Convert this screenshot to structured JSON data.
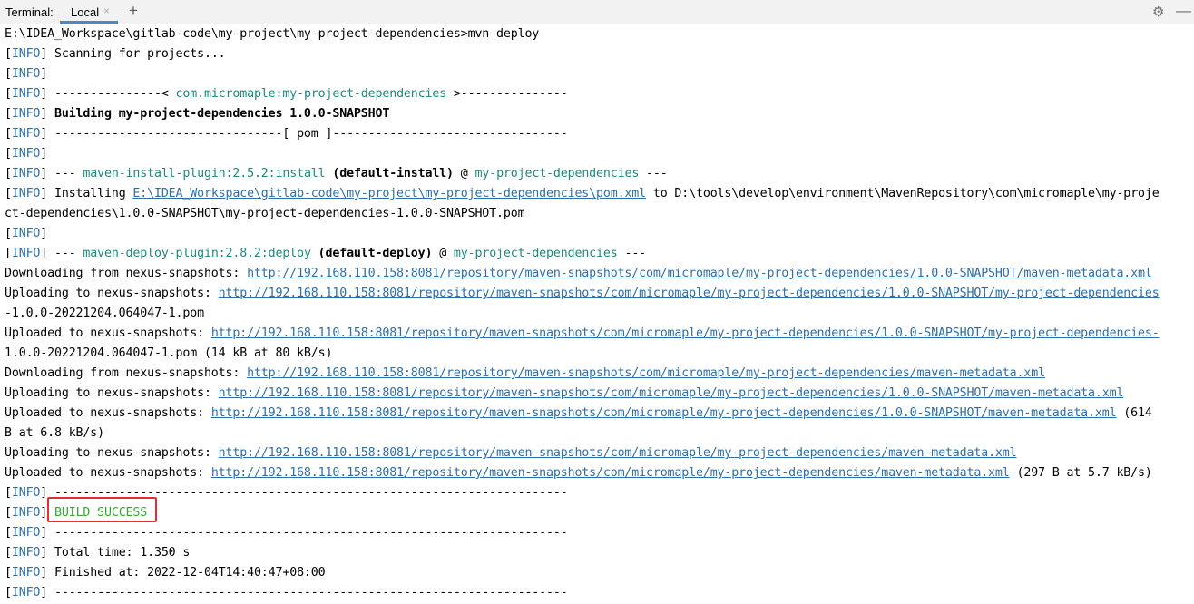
{
  "toolbar": {
    "title": "Terminal:",
    "tab_label": "Local",
    "tab_close": "×",
    "add": "+",
    "settings": "⚙",
    "minimize": "—"
  },
  "info_tag": "INFO",
  "lines": {
    "l0": "E:\\IDEA_Workspace\\gitlab-code\\my-project\\my-project-dependencies>mvn deploy",
    "l1": " Scanning for projects...",
    "l3a": " ---------------< ",
    "l3b": "com.micromaple:my-project-dependencies",
    "l3c": " >---------------",
    "l4": " Building my-project-dependencies 1.0.0-SNAPSHOT",
    "l5": " --------------------------------[ pom ]---------------------------------",
    "l7a": " --- ",
    "l7b": "maven-install-plugin:2.5.2:install",
    "l7c": "(default-install)",
    "l7d": " @ ",
    "l7e": "my-project-dependencies",
    "l7f": " ---",
    "l8a": " Installing ",
    "l8b": "E:\\IDEA_Workspace\\gitlab-code\\my-project\\my-project-dependencies\\pom.xml",
    "l8c": " to D:\\tools\\develop\\environment\\MavenRepository\\com\\micromaple\\my-proje",
    "l9": "ct-dependencies\\1.0.0-SNAPSHOT\\my-project-dependencies-1.0.0-SNAPSHOT.pom",
    "l11a": " --- ",
    "l11b": "maven-deploy-plugin:2.8.2:deploy",
    "l11c": "(default-deploy)",
    "l11d": " @ ",
    "l11e": "my-project-dependencies",
    "l11f": " ---",
    "l12a": "Downloading from nexus-snapshots: ",
    "l12b": "http://192.168.110.158:8081/repository/maven-snapshots/com/micromaple/my-project-dependencies/1.0.0-SNAPSHOT/maven-metadata.xml",
    "l13a": "Uploading to nexus-snapshots: ",
    "l13b": "http://192.168.110.158:8081/repository/maven-snapshots/com/micromaple/my-project-dependencies/1.0.0-SNAPSHOT/my-project-dependencies",
    "l14": "-1.0.0-20221204.064047-1.pom",
    "l15a": "Uploaded to nexus-snapshots: ",
    "l15b": "http://192.168.110.158:8081/repository/maven-snapshots/com/micromaple/my-project-dependencies/1.0.0-SNAPSHOT/my-project-dependencies-",
    "l16": "1.0.0-20221204.064047-1.pom (14 kB at 80 kB/s)",
    "l17a": "Downloading from nexus-snapshots: ",
    "l17b": "http://192.168.110.158:8081/repository/maven-snapshots/com/micromaple/my-project-dependencies/maven-metadata.xml",
    "l18a": "Uploading to nexus-snapshots: ",
    "l18b": "http://192.168.110.158:8081/repository/maven-snapshots/com/micromaple/my-project-dependencies/1.0.0-SNAPSHOT/maven-metadata.xml",
    "l19a": "Uploaded to nexus-snapshots: ",
    "l19b": "http://192.168.110.158:8081/repository/maven-snapshots/com/micromaple/my-project-dependencies/1.0.0-SNAPSHOT/maven-metadata.xml",
    "l19c": " (614",
    "l20": "B at 6.8 kB/s)",
    "l21a": "Uploading to nexus-snapshots: ",
    "l21b": "http://192.168.110.158:8081/repository/maven-snapshots/com/micromaple/my-project-dependencies/maven-metadata.xml",
    "l22a": "Uploaded to nexus-snapshots: ",
    "l22b": "http://192.168.110.158:8081/repository/maven-snapshots/com/micromaple/my-project-dependencies/maven-metadata.xml",
    "l22c": " (297 B at 5.7 kB/s)",
    "dash": " ------------------------------------------------------------------------",
    "l24": "BUILD SUCCESS",
    "l26": " Total time: 1.350 s",
    "l27": " Finished at: 2022-12-04T14:40:47+08:00"
  },
  "colors": {
    "info": "#2e6ea9",
    "plugin": "#1c8a7c",
    "link": "#2e6ea9",
    "success": "#32a832",
    "highlight": "#e53030"
  }
}
